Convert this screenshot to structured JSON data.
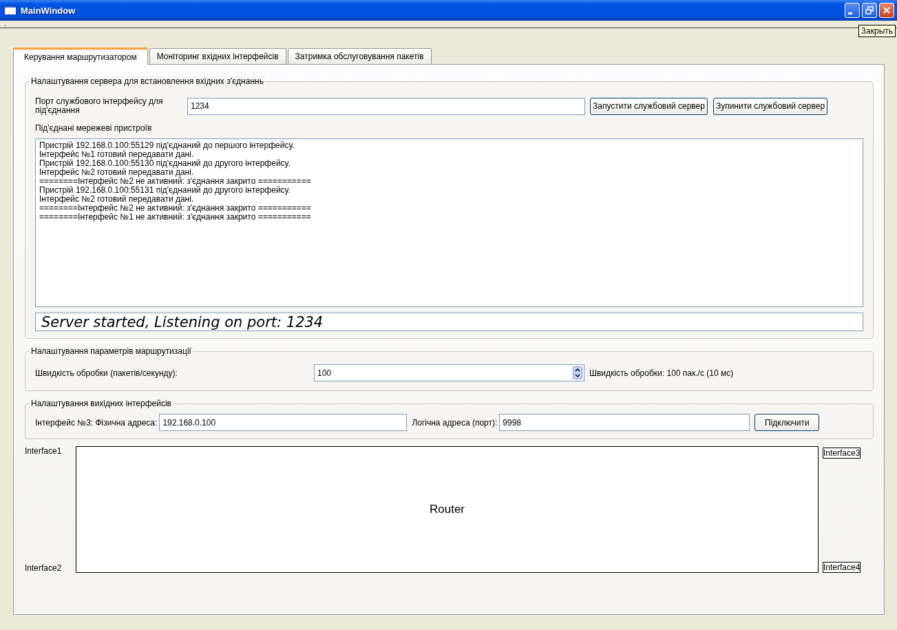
{
  "window": {
    "title": "MainWindow",
    "tooltip": "Закрыть"
  },
  "menu_bar": {
    "items": [
      {
        "label": "."
      }
    ]
  },
  "tabs": [
    {
      "label": "Керування маршрутизатором",
      "selected": true
    },
    {
      "label": "Моніторинг вхідних інтерфейсів",
      "selected": false
    },
    {
      "label": "Затримка обслуговування пакетів",
      "selected": false
    }
  ],
  "server_group": {
    "title": "Налаштування сервера для встановлення вхідних з'єднаннь",
    "port_label": "Порт службового інтерфейсу для під'єднання",
    "port_value": "1234",
    "buttons": [
      "Запустити службовий сервер",
      "Зупинити службовий сервер"
    ],
    "devices_label": "Під'єднані мережеві пристроїв",
    "log_lines": [
      "Пристрій 192.168.0.100:55129 під'єднаний до першого інтерфейсу.",
      "Інтерфейс №1 готовий передавати дані.",
      "Пристрій 192.168.0.100:55130 під'єднаний до другого інтерфейсу.",
      "Інтерфейс №2 готовий передавати дані.",
      "========Інтерфейс №2 не активний: з'єднання закрито ===========",
      "Пристрій 192.168.0.100:55131 під'єднаний до другого інтерфейсу.",
      "Інтерфейс №2 готовий передавати дані.",
      "========Інтерфейс №2 не активний: з'єднання закрито ===========",
      "========Інтерфейс №1 не активний: з'єднання закрито ==========="
    ],
    "status": "Server started, Listening on port: 1234"
  },
  "routing_group": {
    "title": "Налаштування параметрів маршрутизації",
    "speed_label": "Швидкість обробки (пакетів/секунду):",
    "speed_value": "100",
    "speed_reading": "Швидкість обробки: 100 пак./с (10 мс)"
  },
  "output_group": {
    "title": "Налаштування вихідних інтерфейсів",
    "physical_label": "Інтерфейс №3: Фізична адреса:",
    "physical_value": "192.168.0.100",
    "logical_label": "Логічна адреса (порт):",
    "logical_value": "9998",
    "connect_button": "Підключити"
  },
  "router": {
    "label": "Router",
    "interfaces": [
      {
        "label": "Interface1",
        "active": false
      },
      {
        "label": "Interface2",
        "active": false
      },
      {
        "label": "Interface3",
        "active": true
      },
      {
        "label": "Interface4",
        "active": true
      }
    ]
  }
}
